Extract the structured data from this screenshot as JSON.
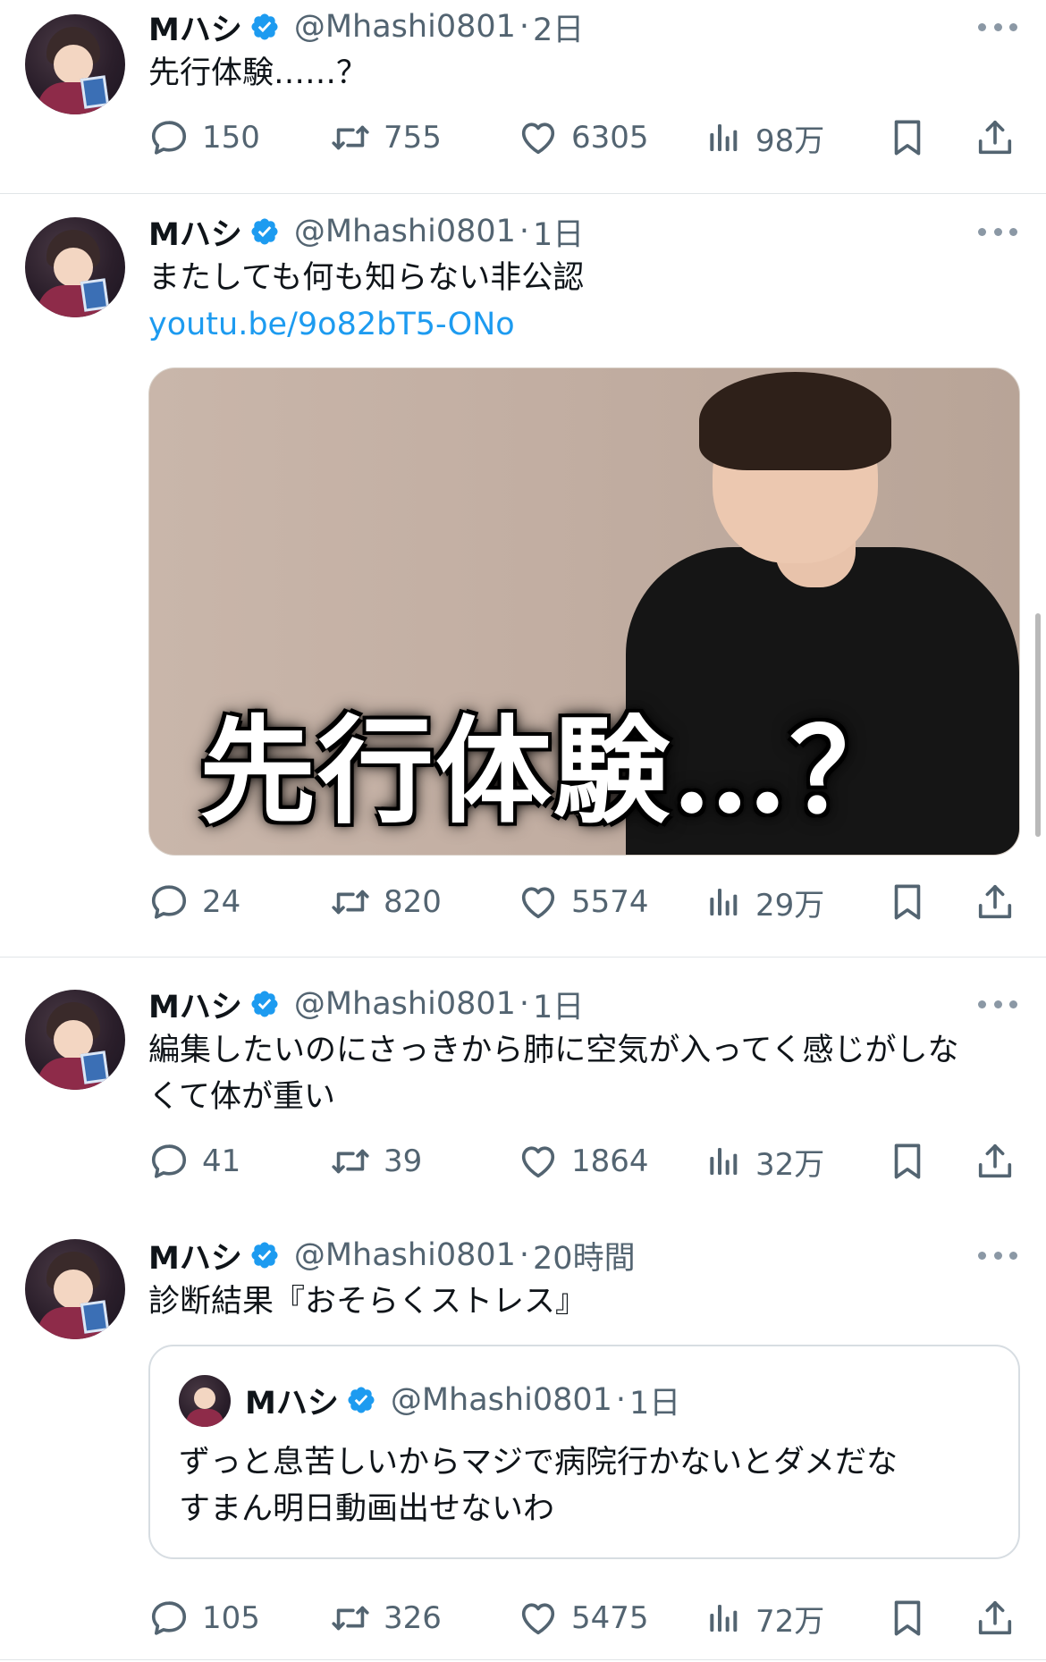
{
  "tweets": [
    {
      "name": "Mハシ",
      "handle": "@Mhashi0801",
      "separator": "·",
      "time": "2日",
      "text": "先行体験……？",
      "replies": "150",
      "retweets": "755",
      "likes": "6305",
      "views": "98万"
    },
    {
      "name": "Mハシ",
      "handle": "@Mhashi0801",
      "separator": "·",
      "time": "1日",
      "text": "またしても何も知らない非公認",
      "link": "youtu.be/9o82bT5-ONo",
      "media_caption": "先行体験…？",
      "replies": "24",
      "retweets": "820",
      "likes": "5574",
      "views": "29万"
    },
    {
      "name": "Mハシ",
      "handle": "@Mhashi0801",
      "separator": "·",
      "time": "1日",
      "text": "編集したいのにさっきから肺に空気が入ってく感じがしな\nくて体が重い",
      "replies": "41",
      "retweets": "39",
      "likes": "1864",
      "views": "32万"
    },
    {
      "name": "Mハシ",
      "handle": "@Mhashi0801",
      "separator": "·",
      "time": "20時間",
      "text": "診断結果『おそらくストレス』",
      "quote": {
        "name": "Mハシ",
        "handle": "@Mhashi0801",
        "separator": "·",
        "time": "1日",
        "text": "ずっと息苦しいからマジで病院行かないとダメだな\nすまん明日動画出せないわ"
      },
      "replies": "105",
      "retweets": "326",
      "likes": "5475",
      "views": "72万"
    }
  ],
  "icons": {
    "verified": "verified-badge-icon",
    "more": "more-options-icon",
    "reply": "reply-icon",
    "retweet": "retweet-icon",
    "like": "heart-icon",
    "views": "views-chart-icon",
    "bookmark": "bookmark-icon",
    "share": "share-icon"
  },
  "colors": {
    "text": "#0f1419",
    "secondary": "#536471",
    "link": "#1d9bf0",
    "verified": "#1d9bf0",
    "divider": "#e1e5e8"
  }
}
